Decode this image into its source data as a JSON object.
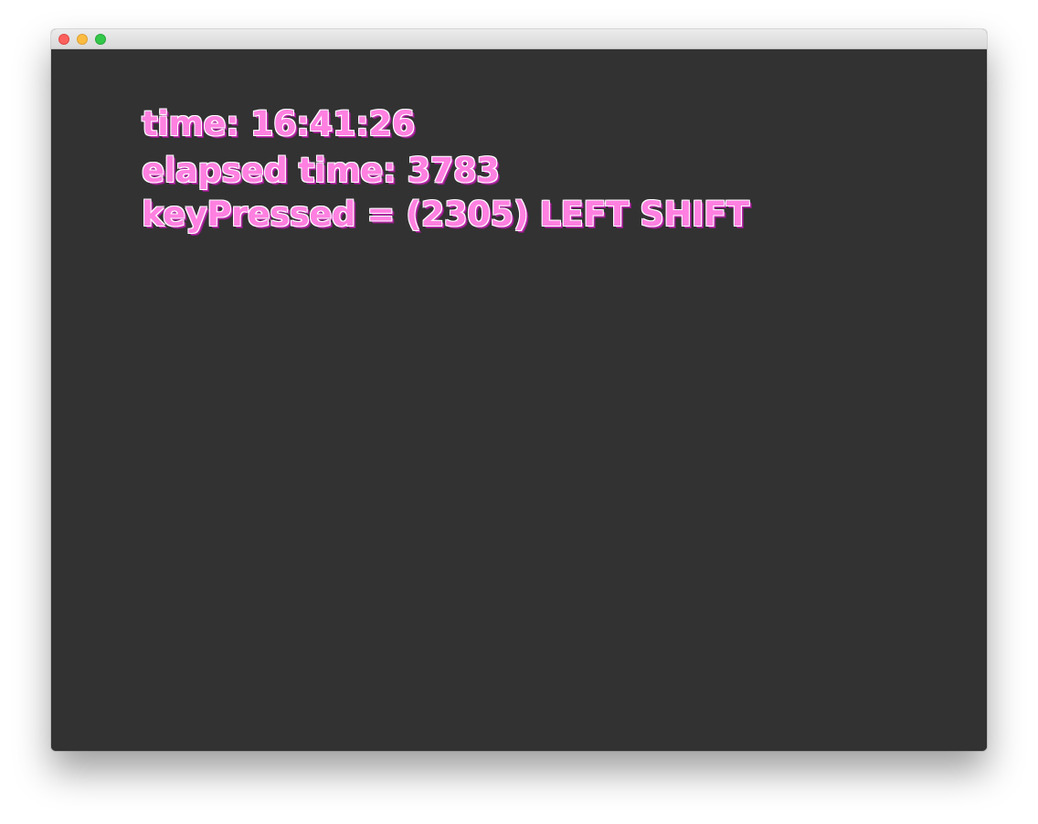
{
  "window": {
    "controls": {
      "close_icon": "close-icon",
      "minimize_icon": "minimize-icon",
      "maximize_icon": "maximize-icon"
    }
  },
  "content": {
    "background": "#323232",
    "text_color": "#ff80e0",
    "time_line": "time: 16:41:26",
    "elapsed_line": "elapsed time: 3783",
    "key_line": "keyPressed = (2305) LEFT SHIFT"
  }
}
